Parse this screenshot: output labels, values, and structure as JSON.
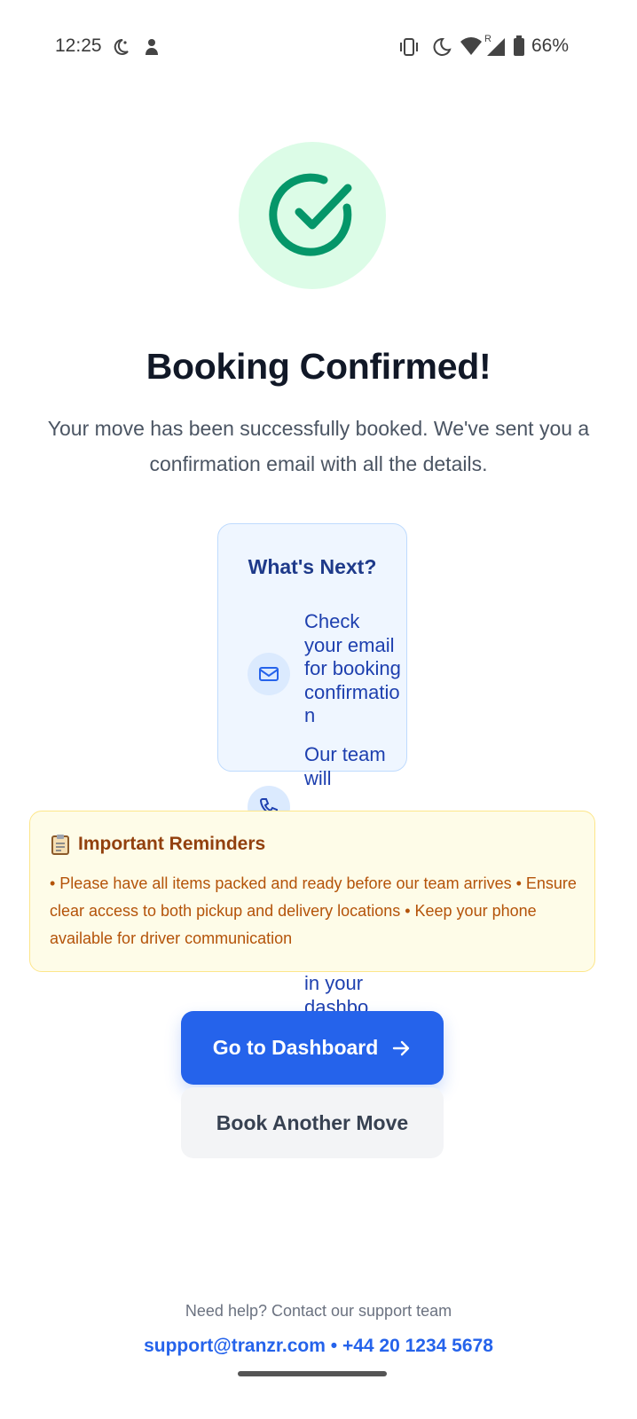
{
  "status_bar": {
    "time": "12:25",
    "battery": "66%",
    "left_icons": [
      "moon-star-icon",
      "notification-icon"
    ],
    "right_icons": [
      "vibrate-icon",
      "do-not-disturb-icon",
      "wifi-icon",
      "signal-icon",
      "battery-icon"
    ]
  },
  "confirmation": {
    "icon": "check-circle-icon",
    "title": "Booking Confirmed!",
    "subtitle": "Your move has been successfully booked. We've sent you a confirmation email with all the details."
  },
  "whats_next": {
    "title": "What's Next?",
    "steps": [
      {
        "icon": "mail-icon",
        "text": "Check your email for booking confirmation"
      },
      {
        "icon": "phone-icon",
        "text": "Our team will"
      },
      {
        "text": "in your dashbo"
      }
    ]
  },
  "reminders": {
    "icon": "clipboard-icon",
    "title": "Important Reminders",
    "text": "• Please have all items packed and ready before our team arrives • Ensure clear access to both pickup and delivery locations • Keep your phone available for driver communication"
  },
  "actions": {
    "dashboard_label": "Go to Dashboard",
    "book_another_label": "Book Another Move"
  },
  "support": {
    "help_text": "Need help? Contact our support team",
    "email": "support@tranzr.com",
    "separator": " • ",
    "phone": "+44 20 1234 5678"
  },
  "colors": {
    "primary": "#2563eb",
    "success": "#059669",
    "success_bg": "#dcfce7",
    "warning_bg": "#fefce8",
    "warning_text": "#92400e"
  }
}
